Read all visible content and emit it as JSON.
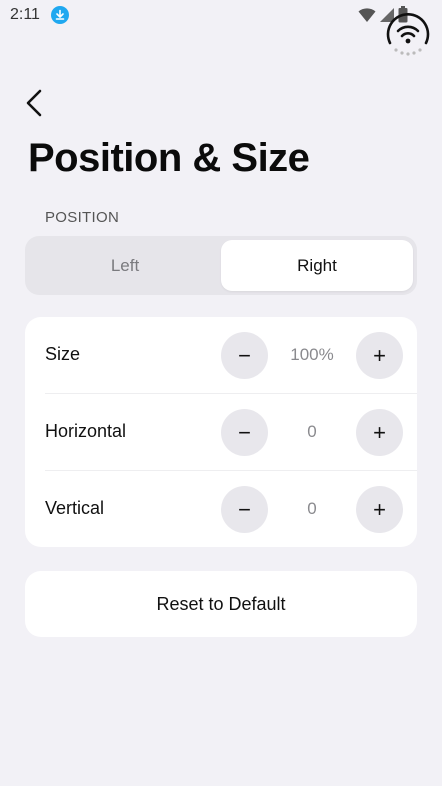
{
  "status_bar": {
    "time": "2:11",
    "icons": [
      "download-icon",
      "wifi-icon",
      "signal-icon",
      "battery-icon"
    ]
  },
  "header": {
    "back_icon": "chevron-left-icon",
    "title": "Position & Size"
  },
  "position": {
    "section_label": "POSITION",
    "options": [
      "Left",
      "Right"
    ],
    "selected": "Right"
  },
  "adjustments": {
    "rows": [
      {
        "label": "Size",
        "value": "100%",
        "minus": "−",
        "plus": "+"
      },
      {
        "label": "Horizontal",
        "value": "0",
        "minus": "−",
        "plus": "+"
      },
      {
        "label": "Vertical",
        "value": "0",
        "minus": "−",
        "plus": "+"
      }
    ]
  },
  "actions": {
    "reset_label": "Reset to Default"
  },
  "colors": {
    "background": "#f2f1f6",
    "card": "#ffffff",
    "stepper": "#e8e7ec",
    "accent_badge": "#1fa8f0"
  }
}
